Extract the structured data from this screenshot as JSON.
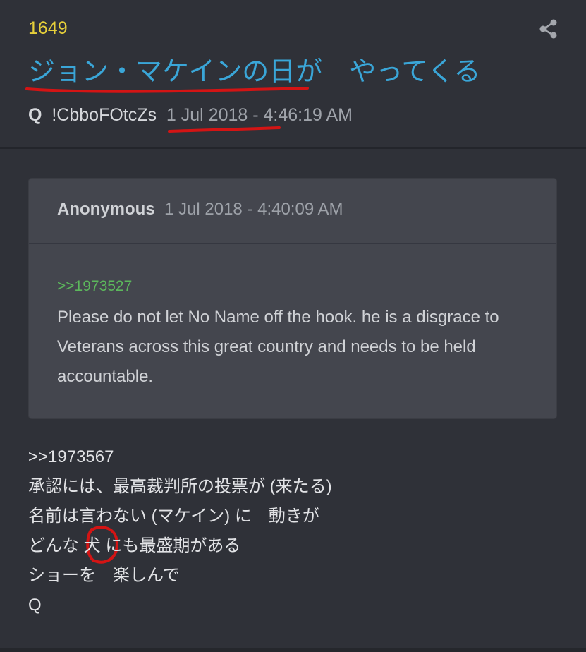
{
  "post": {
    "number": "1649",
    "title": "ジョン・マケインの日が　やってくる",
    "author": "Q",
    "tripcode": "!CbboFOtcZs",
    "date": "1 Jul 2018 - 4:46:19 AM",
    "share_icon": "share-icon"
  },
  "quote": {
    "author": "Anonymous",
    "date": "1 Jul 2018 - 4:40:09 AM",
    "ref": ">>1973527",
    "body": "Please do not let No Name off the hook. he is a disgrace to Veterans across this great country and needs to be held accountable."
  },
  "body": {
    "lines": [
      ">>1973567",
      "承認には、最高裁判所の投票が (来たる)",
      "名前は言わない (マケイン) に　動きが",
      "どんな 犬 にも最盛期がある",
      "ショーを　楽しんで",
      "Q"
    ]
  },
  "colors": {
    "background": "#2f3138",
    "post_number": "#e6cf3a",
    "title": "#3aa6d8",
    "quote_ref": "#5cb85c",
    "annotation": "#d41414"
  }
}
